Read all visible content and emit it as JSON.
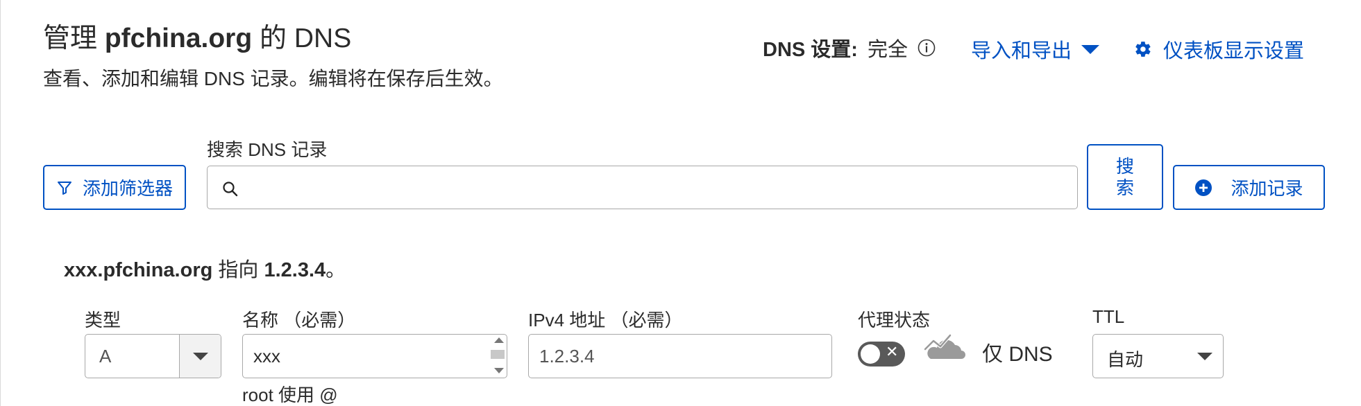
{
  "header": {
    "title_prefix": "管理 ",
    "title_domain": "pfchina.org",
    "title_suffix": " 的 DNS",
    "subtitle": "查看、添加和编辑 DNS 记录。编辑将在保存后生效。",
    "dns_setting_label": "DNS 设置:",
    "dns_setting_value": "完全",
    "import_export_label": "导入和导出",
    "dashboard_settings_label": "仪表板显示设置"
  },
  "toolbar": {
    "filter_label": "添加筛选器",
    "search_label": "搜索 DNS 记录",
    "search_value": "",
    "search_button_label": "搜索",
    "add_record_label": "添加记录"
  },
  "record": {
    "note_host": "xxx.pfchina.org",
    "note_middle": " 指向 ",
    "note_target": "1.2.3.4",
    "note_end": "。",
    "type_label": "类型",
    "type_value": "A",
    "name_label": "名称 （必需）",
    "name_value": "xxx",
    "name_hint": "root 使用 @",
    "ipv4_label": "IPv4 地址 （必需）",
    "ipv4_value": "1.2.3.4",
    "proxy_label": "代理状态",
    "proxy_text": "仅 DNS",
    "ttl_label": "TTL",
    "ttl_value": "自动"
  },
  "icons": {
    "info": "info-circle-icon",
    "caret": "caret-down-icon",
    "gear": "gear-icon",
    "filter": "filter-icon",
    "search": "search-icon",
    "plus": "plus-circle-icon",
    "cloud": "cloud-icon"
  },
  "colors": {
    "accent": "#0051c3",
    "text": "#2b2b2b",
    "border": "#a8a8a8",
    "toggle_off": "#595959",
    "cloud_gray": "#9a9a9a"
  }
}
